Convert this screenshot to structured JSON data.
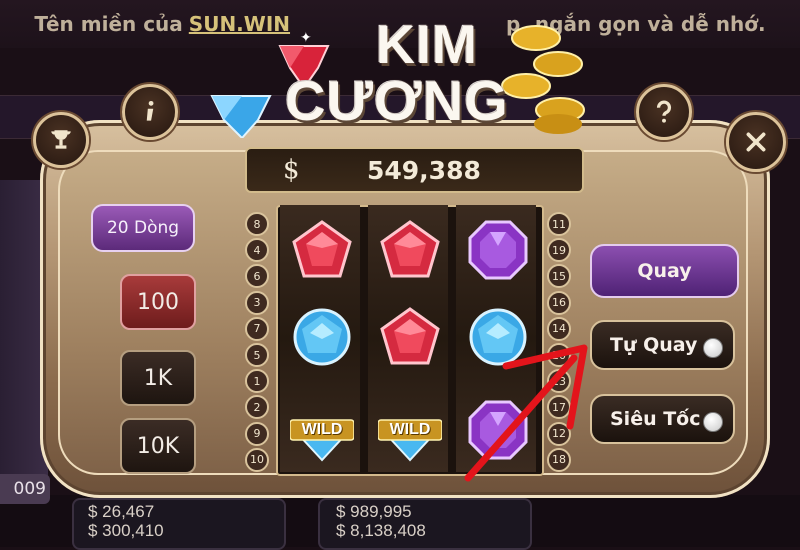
{
  "background": {
    "banner": {
      "prefix": "Tên miền của",
      "brand": "SUN.WIN",
      "suffix": "p, ngắn gọn và dễ nhớ."
    },
    "chip_value": "009",
    "jackpots_left": [
      "$ 26,467",
      "$ 300,410"
    ],
    "jackpots_right": [
      "$ 989,995",
      "$ 8,138,408"
    ]
  },
  "game": {
    "title_line1": "KIM",
    "title_line2": "CƯƠNG",
    "balance_currency": "$",
    "balance": "549,388"
  },
  "left_panel": {
    "lines_label": "20 Dòng",
    "bets": [
      {
        "label": "100",
        "active": true
      },
      {
        "label": "1K",
        "active": false
      },
      {
        "label": "10K",
        "active": false
      }
    ]
  },
  "reels": {
    "symbols": [
      [
        "ruby",
        "diamond",
        "wild"
      ],
      [
        "ruby",
        "ruby",
        "wild"
      ],
      [
        "amethyst",
        "diamond",
        "amethyst"
      ]
    ],
    "wild_label": "WILD",
    "left_lines": [
      "8",
      "4",
      "6",
      "3",
      "7",
      "5",
      "1",
      "2",
      "9",
      "10"
    ],
    "right_lines": [
      "11",
      "19",
      "15",
      "16",
      "14",
      "20",
      "13",
      "17",
      "12",
      "18"
    ]
  },
  "right_panel": {
    "spin_label": "Quay",
    "auto_label": "Tự Quay",
    "turbo_label": "Siêu Tốc"
  },
  "icons": {
    "top_left": "trophy-icon",
    "info": "info-icon",
    "help": "help-icon",
    "close": "close-icon"
  },
  "colors": {
    "frame_gold": "#c8ad86",
    "purple_button": "#7a3d9c",
    "active_bet": "#8f2a2a",
    "arrow": "#e3141b"
  }
}
